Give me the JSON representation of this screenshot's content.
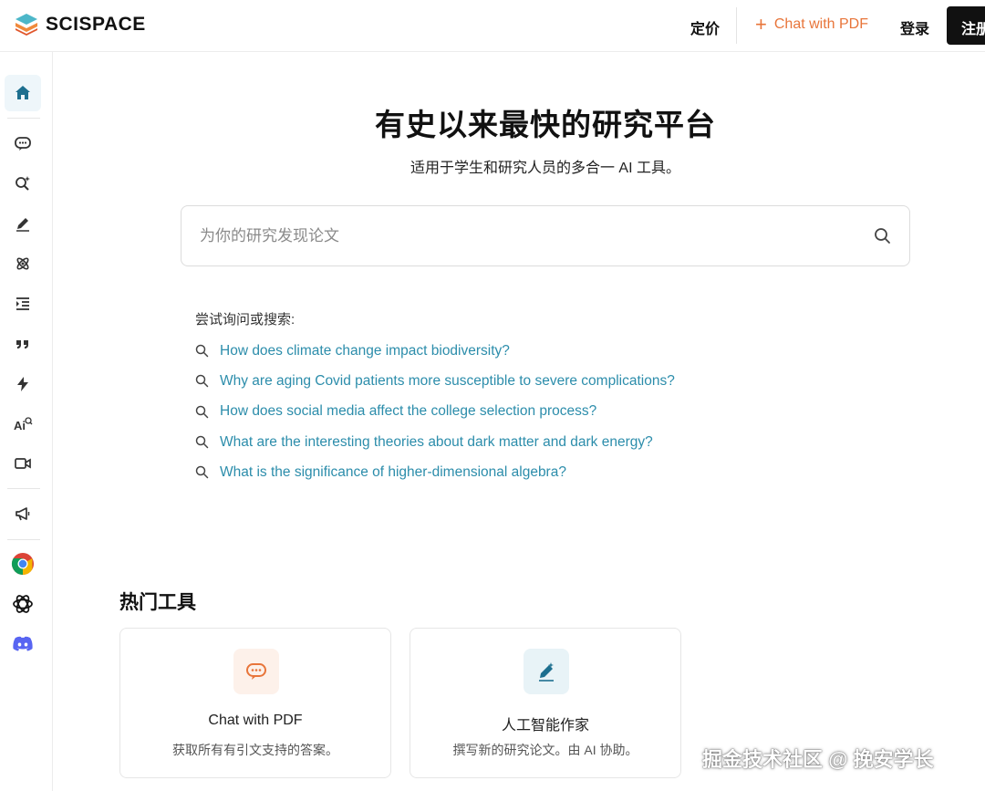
{
  "header": {
    "logo_text": "SCISPACE",
    "pricing": "定价",
    "chat_pdf": "Chat with PDF",
    "login": "登录",
    "signup": "注册"
  },
  "hero": {
    "title": "有史以来最快的研究平台",
    "subtitle": "适用于学生和研究人员的多合一 AI 工具。"
  },
  "search": {
    "placeholder": "为你的研究发现论文"
  },
  "suggestions": {
    "label": "尝试询问或搜索:",
    "items": [
      "How does climate change impact biodiversity?",
      "Why are aging Covid patients more susceptible to severe complications?",
      "How does social media affect the college selection process?",
      "What are the interesting theories about dark matter and dark energy?",
      "What is the significance of higher-dimensional algebra?"
    ]
  },
  "popular": {
    "title": "热门工具",
    "cards": [
      {
        "title": "Chat with PDF",
        "desc": "获取所有有引文支持的答案。"
      },
      {
        "title": "人工智能作家",
        "desc": "撰写新的研究论文。由 AI 协助。"
      }
    ]
  },
  "sidebar_icons": [
    "home-icon",
    "chat-icon",
    "search-ai-icon",
    "pen-icon",
    "atom-icon",
    "outline-icon",
    "quote-icon",
    "lightning-icon",
    "ai-detector-icon",
    "video-icon",
    "megaphone-icon",
    "chrome-icon",
    "openai-icon",
    "discord-icon"
  ],
  "watermark": "掘金技术社区 @ 挽安学长",
  "colors": {
    "accent_orange": "#e8753a",
    "link_teal": "#2c8dab",
    "sidebar_active": "#1d6f8f"
  }
}
